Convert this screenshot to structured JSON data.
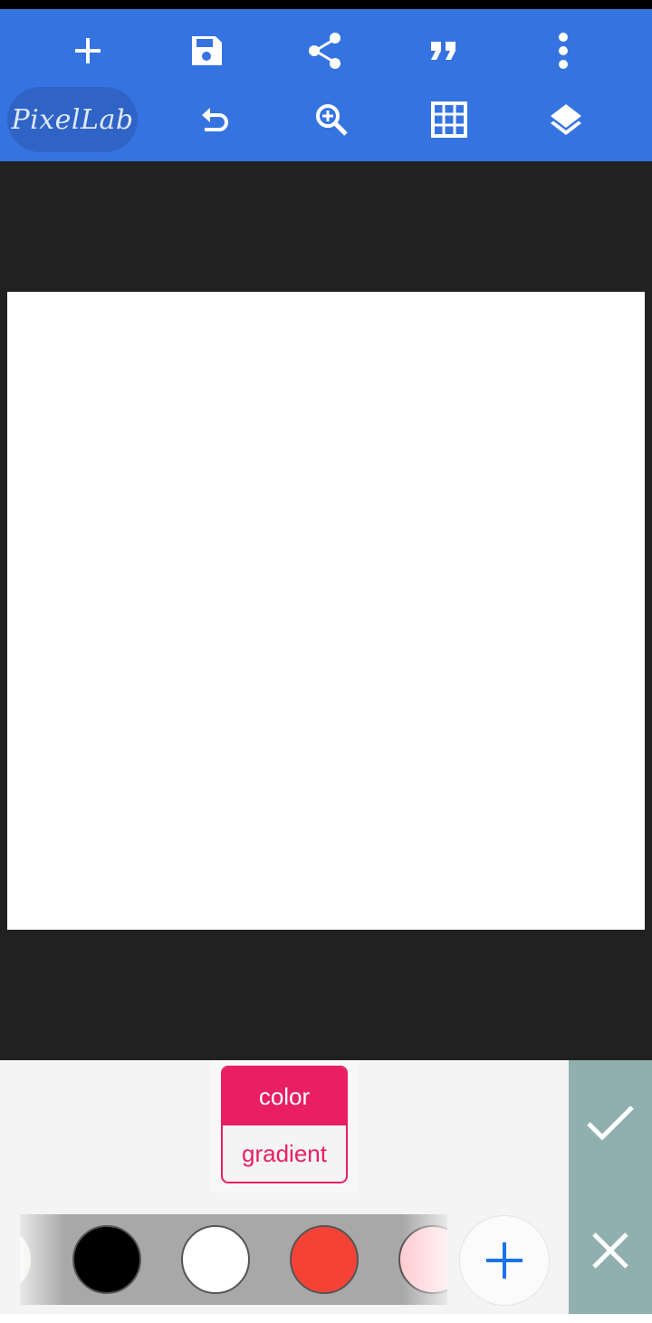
{
  "app": {
    "logo_text": "PixelLab"
  },
  "toolbar": {
    "row1": [
      "plus-icon",
      "save-icon",
      "share-icon",
      "quote-icon",
      "more-vert-icon"
    ],
    "row2": [
      "undo-icon",
      "zoom-in-icon",
      "grid-icon",
      "layers-icon"
    ]
  },
  "fill_mode": {
    "options": [
      "color",
      "gradient"
    ],
    "selected": "color"
  },
  "swatches": {
    "colors": [
      "#e8e8e0",
      "#000000",
      "#ffffff",
      "#f44336",
      "#ffcdd2"
    ]
  },
  "colors": {
    "toolbar": "#3574e0",
    "accent": "#e91e63",
    "side_panel": "#90b0b0",
    "add_icon": "#1a73e8"
  },
  "actions": {
    "confirm": "check-icon",
    "cancel": "close-icon"
  }
}
